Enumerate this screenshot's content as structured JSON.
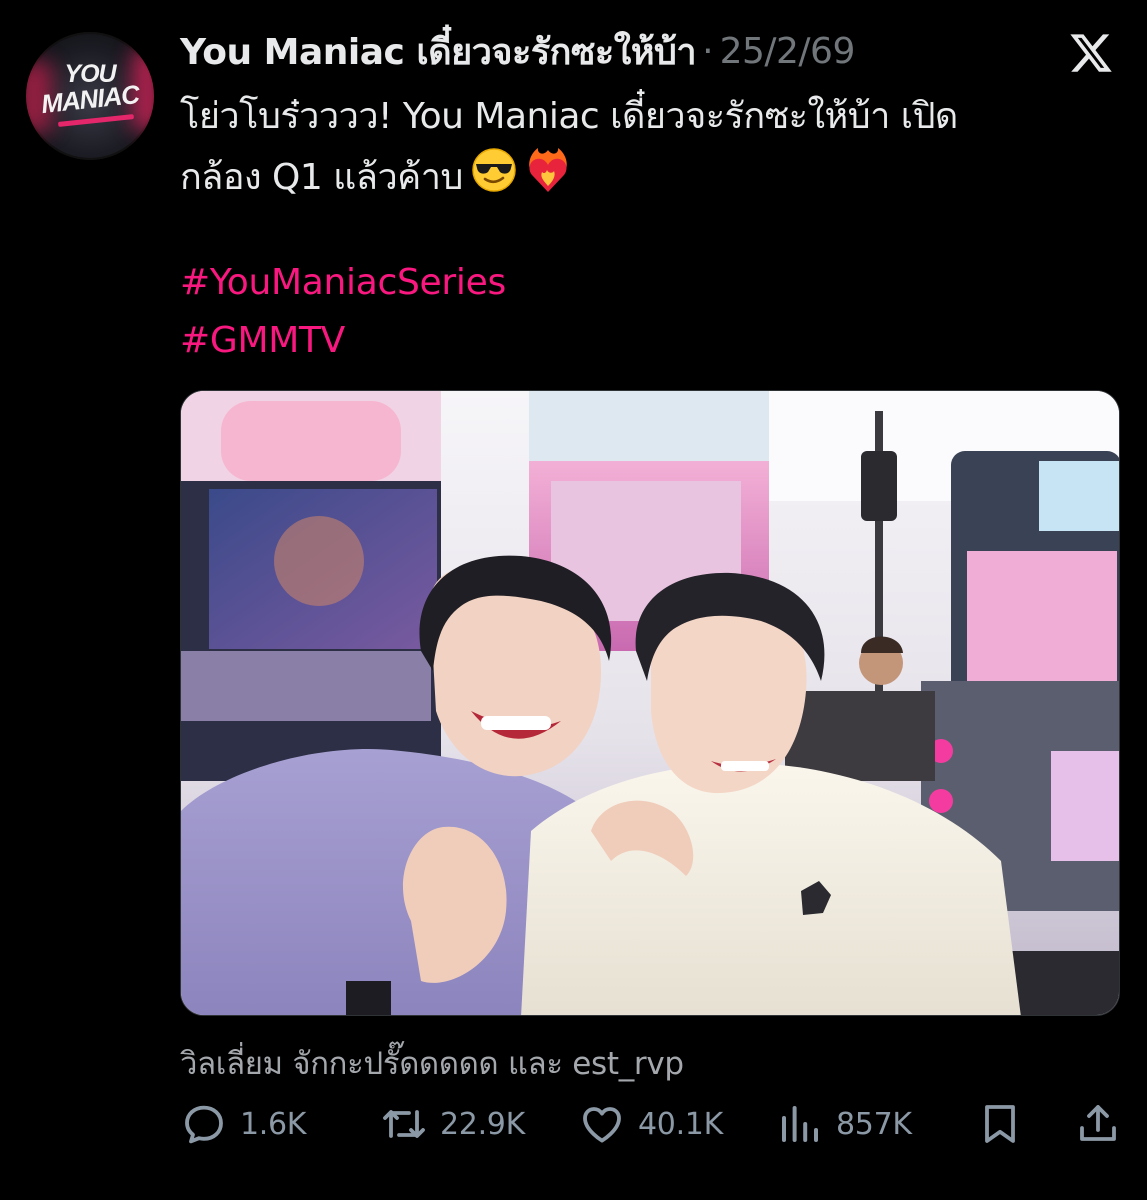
{
  "author": {
    "name": "You Maniac เดี๋ยวจะรักซะให้บ้า",
    "avatar_icon": "you-maniac-logo",
    "logo_text_top": "YOU",
    "logo_text_main": "MANIAC"
  },
  "meta": {
    "separator": "·",
    "date": "25/2/69",
    "platform_icon": "x-logo-icon"
  },
  "tweet": {
    "line1": "โย่วโบร๋วววว! You Maniac เดี๋ยวจะรักซะให้บ้า เปิด",
    "line2": "กล้อง Q1 แล้วค้าบ",
    "emojis": [
      "smiling-face-with-sunglasses",
      "heart-on-fire"
    ],
    "hashtags": [
      "#YouManiacSeries",
      "#GMMTV"
    ]
  },
  "media": {
    "tagged": "วิลเลี่ยม จักกะปรั๊ดดดดด และ est_rvp"
  },
  "stats": {
    "replies": "1.6K",
    "reposts": "22.9K",
    "likes": "40.1K",
    "views": "857K"
  },
  "colors": {
    "accent": "#f91880",
    "muted": "#71767b",
    "text": "#e7e9ea",
    "background": "#000000"
  }
}
